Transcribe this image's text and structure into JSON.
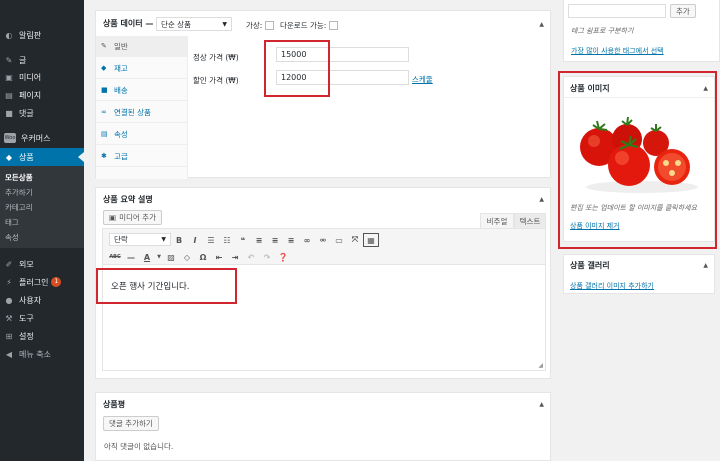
{
  "sidebar": {
    "items": [
      {
        "label": "알림판",
        "icon": "dashboard-icon"
      },
      {
        "label": "글",
        "icon": "pin-icon"
      },
      {
        "label": "미디어",
        "icon": "media-icon"
      },
      {
        "label": "페이지",
        "icon": "page-icon"
      },
      {
        "label": "댓글",
        "icon": "comment-icon"
      },
      {
        "label": "우커머스",
        "icon": "woo-icon"
      },
      {
        "label": "상품",
        "icon": "box-icon"
      },
      {
        "label": "외모",
        "icon": "brush-icon"
      },
      {
        "label": "플러그인",
        "icon": "plug-icon",
        "badge": "1"
      },
      {
        "label": "사용자",
        "icon": "user-icon"
      },
      {
        "label": "도구",
        "icon": "wrench-icon"
      },
      {
        "label": "설정",
        "icon": "settings-icon"
      },
      {
        "label": "메뉴 축소",
        "icon": "collapse-icon"
      }
    ],
    "woo_icon_text": "Woo",
    "sub_items": [
      "모든상품",
      "추가하기",
      "카테고리",
      "태그",
      "속성"
    ]
  },
  "product_data": {
    "title": "상품 데이터 —",
    "type_select": "단순 상품",
    "virtual_label": "가상:",
    "downloadable_label": "다운로드 가능:",
    "tabs": [
      {
        "label": "일반",
        "icon": "wrench-icon"
      },
      {
        "label": "재고",
        "icon": "tag-icon"
      },
      {
        "label": "배송",
        "icon": "truck-icon"
      },
      {
        "label": "연결된 상품",
        "icon": "link-icon"
      },
      {
        "label": "속성",
        "icon": "list-icon"
      },
      {
        "label": "고급",
        "icon": "gear-icon"
      }
    ],
    "regular_price_label": "정상 가격 (₩)",
    "regular_price_value": "15000",
    "sale_price_label": "할인 가격 (₩)",
    "sale_price_value": "12000",
    "schedule_link": "스케줄"
  },
  "short_description": {
    "title": "상품 요약 설명",
    "add_media": "미디어 추가",
    "tab_visual": "비주얼",
    "tab_text": "텍스트",
    "format_select": "단락",
    "content": "오픈 행사 기간입니다."
  },
  "reviews": {
    "title": "상품평",
    "add_comment": "댓글 추가하기",
    "empty": "아직 댓글이 없습니다."
  },
  "tags_box": {
    "add_button": "추가",
    "hint": "태그 쉼표로 구분하기",
    "popular_link": "가장 많이 사용한 태그에서 선택"
  },
  "product_image": {
    "title": "상품 이미지",
    "hint": "편집 또는 업데이트 할 이미지를 클릭하세요",
    "remove_link": "상품 이미지 제거"
  },
  "gallery": {
    "title": "상품 갤러리",
    "add_link": "상품 갤러리 이미지 추가하기"
  },
  "colors": {
    "sidebar_bg": "#23282d",
    "active_blue": "#0073aa",
    "highlight_red": "#d0272e"
  }
}
